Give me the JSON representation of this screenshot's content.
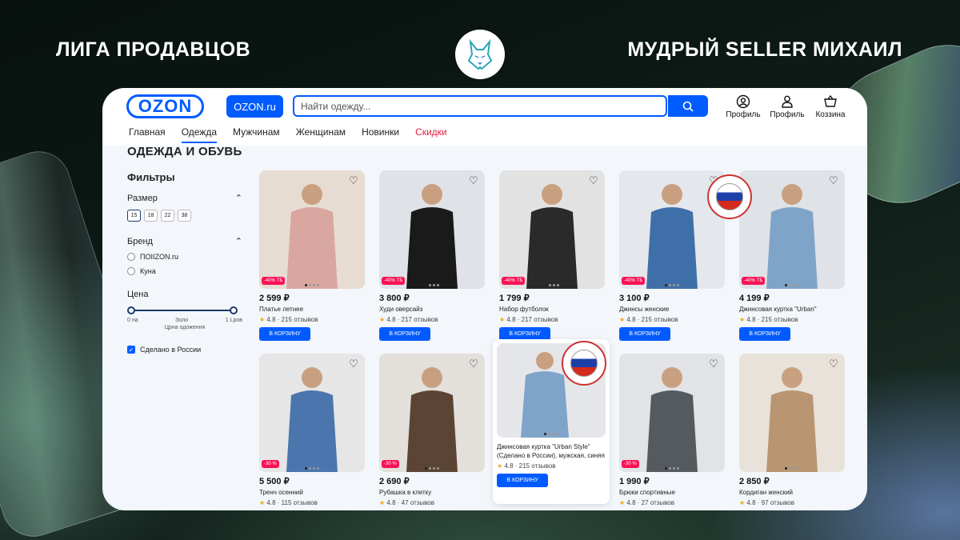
{
  "header": {
    "left_title": "ЛИГА ПРОДАВЦОВ",
    "right_title": "МУДРЫЙ SELLER МИХАИЛ"
  },
  "ozon": {
    "logo_text": "OZON",
    "domain_button": "OZON.ru",
    "search_placeholder": "Найти одежду...",
    "actions": [
      "Профиль",
      "Профиль",
      "Коззина"
    ],
    "nav": [
      "Главная",
      "Одежда",
      "Мужчинам",
      "Женщинам",
      "Новинки",
      "Скидки"
    ],
    "active_nav": "Одежда",
    "page_title": "ОДЕЖДА И ОБУВЬ",
    "accent_color": "#005bff",
    "sale_color": "#e02040"
  },
  "filters": {
    "title": "Фильтры",
    "size_label": "Размер",
    "sizes": [
      "15",
      "18",
      "22",
      "38"
    ],
    "selected_size": "15",
    "brand_label": "Бренд",
    "brands": [
      "ПОIIZON.ru",
      "Куна"
    ],
    "price_label": "Цена",
    "price_ticks": [
      "0 на",
      "Золо",
      "1 Lpов"
    ],
    "price_caption": "Црна одоження",
    "made_in_russia": "Сделано в России",
    "made_in_russia_checked": true
  },
  "seal": {
    "top": "СДЕЛАНО В РОССИИ",
    "bottom": "MADE IN RUSSIA"
  },
  "cart_label": "В КОРЗИНУ",
  "products": [
    {
      "price": "2 599 ₽",
      "name": "Платье летнее",
      "rating": "4.8",
      "reviews": "· 215 отзывов",
      "badge": "-40% ТБ"
    },
    {
      "price": "3 800 ₽",
      "name": "Худи оверсайз",
      "rating": "4.8",
      "reviews": "· 217 отзывов",
      "badge": "-40% ТБ"
    },
    {
      "price": "1 799 ₽",
      "name": "Набор футболок",
      "rating": "4.8",
      "reviews": "· 217 отзывов",
      "badge": "-40% ТБ"
    },
    {
      "price": "3 100 ₽",
      "name": "Джинсы женские",
      "rating": "4.8",
      "reviews": "· 215 отзывов",
      "badge": "-40% ТБ"
    },
    {
      "price": "4 199 ₽",
      "name": "Джинсовая куртка \"Urban\"",
      "rating": "4.8",
      "reviews": "· 215 отзывов",
      "badge": "-40% ТБ"
    },
    {
      "price": "5 500 ₽",
      "name": "Тренч осенний",
      "rating": "4.8",
      "reviews": "· 115 отзывов",
      "badge": "-30 %"
    },
    {
      "price": "2 690 ₽",
      "name": "Рубашка в клетку",
      "rating": "4.8",
      "reviews": "· 47 отзывов",
      "badge": "-30 %"
    },
    {
      "price": "1 990 ₽",
      "name": "Брюки спортивные",
      "rating": "4.8",
      "reviews": "· 27 отзывов",
      "badge": "-30 %"
    },
    {
      "price": "2 850 ₽",
      "name": "Кордиган женский",
      "rating": "4.8",
      "reviews": "· 97 отзывов",
      "badge": ""
    }
  ],
  "featured": {
    "name": "Джинсовая куртка \"Urban Style\" (Сделано в России), мужская, синяя",
    "rating": "4.8",
    "reviews": "· 215 отзывов"
  }
}
